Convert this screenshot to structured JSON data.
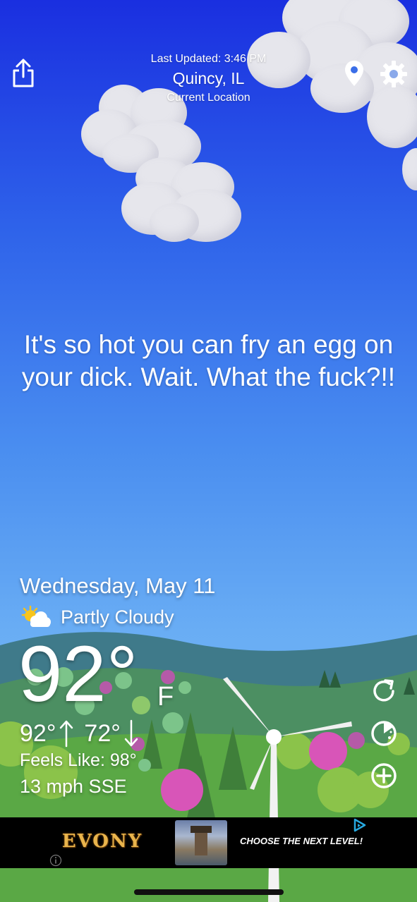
{
  "header": {
    "last_updated": "Last Updated: 3:46 PM",
    "city": "Quincy, IL",
    "location_note": "Current Location"
  },
  "quote": "It's so hot you can fry an egg on your dick. Wait. What the fuck?!!",
  "weather": {
    "date": "Wednesday, May 11",
    "condition": "Partly Cloudy",
    "condition_icon": "partly-cloudy-icon",
    "temperature": "92°",
    "unit": "F",
    "high": "92°",
    "low": "72°",
    "feels_like": "Feels Like: 98°",
    "wind": "13 mph SSE"
  },
  "ad": {
    "brand": "EVONY",
    "tagline": "CHOOSE THE NEXT LEVEL!"
  },
  "icons": {
    "share": "share-icon",
    "location": "location-pin-icon",
    "settings": "gear-icon",
    "refresh": "refresh-icon",
    "radar": "radar-icon",
    "add": "add-icon"
  },
  "colors": {
    "sky_top": "#1a2fe0",
    "sky_bottom": "#7cc0f6",
    "grass": "#5aa845",
    "ad_background": "#000000"
  }
}
